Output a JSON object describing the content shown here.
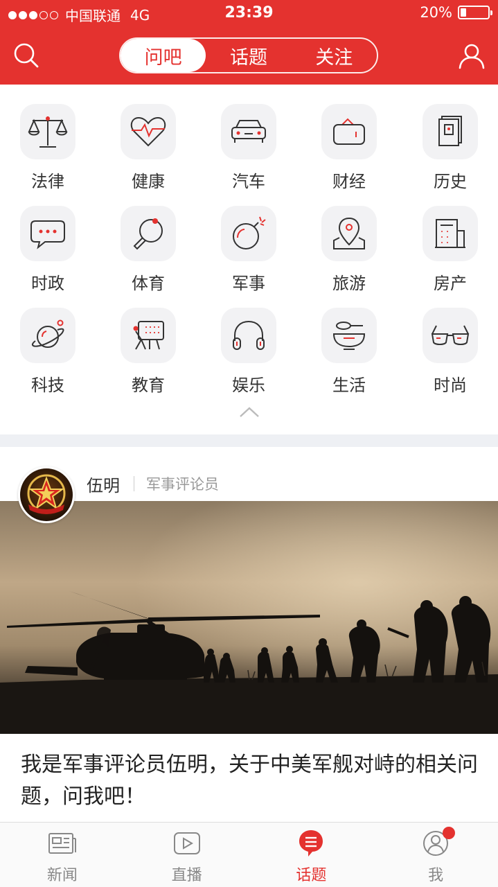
{
  "status_bar": {
    "carrier": "中国联通",
    "network": "4G",
    "time": "23:39",
    "battery": "20%",
    "battery_level": 0.2,
    "signal_bars": 3
  },
  "header": {
    "tabs": [
      {
        "label": "问吧",
        "active": true
      },
      {
        "label": "话题",
        "active": false
      },
      {
        "label": "关注",
        "active": false
      }
    ],
    "search_icon": "search-icon",
    "user_icon": "user-icon"
  },
  "categories": [
    {
      "label": "法律",
      "icon": "scales-icon"
    },
    {
      "label": "健康",
      "icon": "heartbeat-icon"
    },
    {
      "label": "汽车",
      "icon": "car-icon"
    },
    {
      "label": "财经",
      "icon": "wallet-icon"
    },
    {
      "label": "历史",
      "icon": "book-icon"
    },
    {
      "label": "时政",
      "icon": "chat-bubble-icon"
    },
    {
      "label": "体育",
      "icon": "ping-pong-icon"
    },
    {
      "label": "军事",
      "icon": "bomb-icon"
    },
    {
      "label": "旅游",
      "icon": "map-pin-icon"
    },
    {
      "label": "房产",
      "icon": "building-icon"
    },
    {
      "label": "科技",
      "icon": "planet-icon"
    },
    {
      "label": "教育",
      "icon": "blackboard-icon"
    },
    {
      "label": "娱乐",
      "icon": "headphones-icon"
    },
    {
      "label": "生活",
      "icon": "bowl-icon"
    },
    {
      "label": "时尚",
      "icon": "sunglasses-icon"
    }
  ],
  "card": {
    "author_name": "伍明",
    "author_role": "军事评论员",
    "title": "我是军事评论员伍明，关于中美军舰对峙的相关问题，问我吧！"
  },
  "tabbar": {
    "items": [
      {
        "label": "新闻",
        "icon": "newspaper-icon",
        "active": false
      },
      {
        "label": "直播",
        "icon": "play-icon",
        "active": false
      },
      {
        "label": "话题",
        "icon": "topic-bubble-icon",
        "active": true
      },
      {
        "label": "我",
        "icon": "profile-icon",
        "active": false,
        "badge": true
      }
    ]
  },
  "colors": {
    "brand_red": "#e4322f",
    "tile_bg": "#f2f2f4",
    "icon_stroke": "#333333",
    "icon_accent": "#e4322f"
  }
}
